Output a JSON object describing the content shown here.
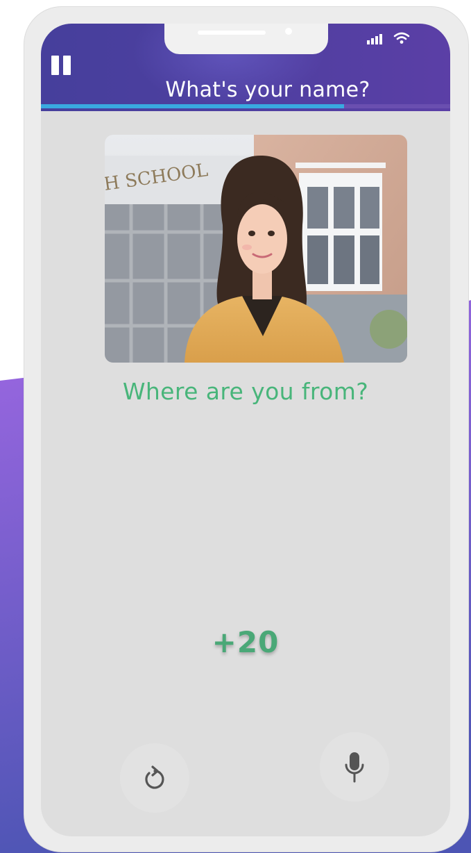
{
  "header": {
    "question": "What's your name?",
    "progress_fraction": 0.74
  },
  "card": {
    "illustration": "woman-in-front-of-school",
    "sign_text": "H SCHOOL"
  },
  "main": {
    "prompt": "Where are you from?",
    "score": "+20"
  },
  "controls": {
    "replay_icon": "replay-icon",
    "mic_icon": "microphone-icon"
  },
  "colors": {
    "header_start": "#463f9c",
    "header_end": "#5b3fa6",
    "progress": "#39a9e0",
    "prompt_green": "#48b57a",
    "score_green": "#4aa877",
    "screen_bg": "#dedede",
    "background_gradient": [
      "#9a68e0",
      "#4f52b2"
    ]
  }
}
